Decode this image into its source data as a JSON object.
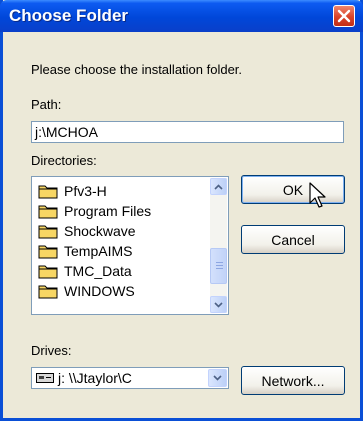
{
  "window": {
    "title": "Choose Folder"
  },
  "prompt": "Please choose the installation folder.",
  "path": {
    "label": "Path:",
    "value": "j:\\MCHOA"
  },
  "directories": {
    "label": "Directories:",
    "items": [
      {
        "label": "Pfv3-H"
      },
      {
        "label": "Program Files"
      },
      {
        "label": "Shockwave"
      },
      {
        "label": "TempAIMS"
      },
      {
        "label": "TMC_Data"
      },
      {
        "label": "WINDOWS"
      }
    ]
  },
  "drives": {
    "label": "Drives:",
    "selected": "j: \\\\Jtaylor\\C"
  },
  "buttons": {
    "ok": "OK",
    "cancel": "Cancel",
    "network": "Network..."
  }
}
